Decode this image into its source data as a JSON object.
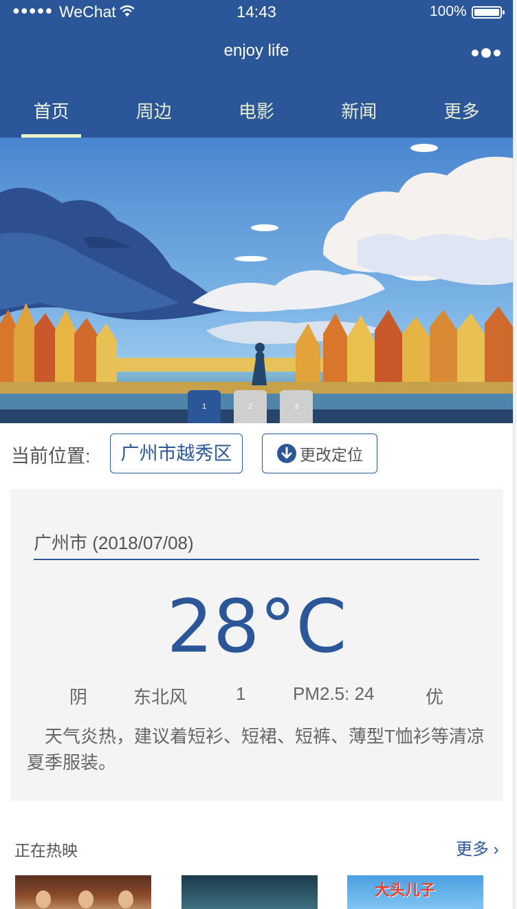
{
  "status_bar": {
    "signal": "●●●●●",
    "carrier": "WeChat",
    "time": "14:43",
    "battery": "100%"
  },
  "nav": {
    "title": "enjoy life",
    "more_icon": "more-dots-icon"
  },
  "tabs": [
    {
      "label": "首页",
      "active": true
    },
    {
      "label": "周边",
      "active": false
    },
    {
      "label": "电影",
      "active": false
    },
    {
      "label": "新闻",
      "active": false
    },
    {
      "label": "更多",
      "active": false
    }
  ],
  "banner": {
    "indicators": [
      "1",
      "2",
      "3"
    ],
    "active_index": 0
  },
  "location": {
    "label": "当前位置:",
    "value": "广州市越秀区",
    "change_button": "更改定位"
  },
  "weather": {
    "city_date": "广州市 (2018/07/08)",
    "temperature": "28°C",
    "condition": "阴",
    "wind_direction": "东北风",
    "wind_level": "1",
    "pm25": "PM2.5: 24",
    "air_quality": "优",
    "advice": "天气炎热，建议着短衫、短裙、短裤、薄型T恤衫等清凉夏季服装。"
  },
  "now_showing": {
    "title": "正在热映",
    "more": "更多 ›",
    "poster3_text": "大头儿子"
  },
  "colors": {
    "primary": "#2b5799",
    "tab_text": "#e6edd0",
    "panel_bg": "#f4f4f4"
  }
}
